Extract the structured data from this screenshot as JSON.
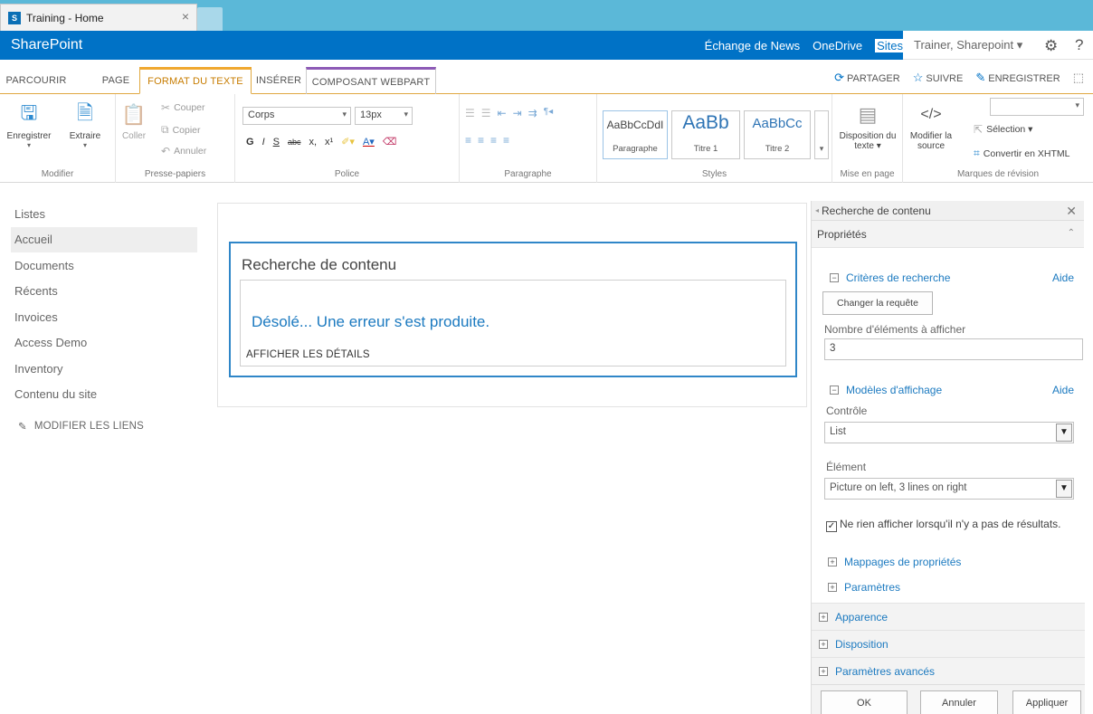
{
  "browser": {
    "tab_title": "Training - Home",
    "close": "×",
    "favicon": "S"
  },
  "suite": {
    "brand": "SharePoint",
    "links": [
      "Échange de News",
      "OneDrive",
      "Sites"
    ],
    "user": "Trainer, Sharepoint ▾",
    "settings_icon": "gear-icon",
    "help": "?"
  },
  "ribbon": {
    "tabs": [
      "PARCOURIR",
      "PAGE",
      "FORMAT DU TEXTE",
      "INSÉRER",
      "COMPOSANT WEBPART"
    ],
    "actions": {
      "share": "PARTAGER",
      "follow": "SUIVRE",
      "save": "ENREGISTRER"
    },
    "groups": {
      "modifier": {
        "label": "Modifier",
        "save": "Enregistrer",
        "extract": "Extraire"
      },
      "clipboard": {
        "label": "Presse-papiers",
        "paste": "Coller",
        "cut": "Couper",
        "copy": "Copier",
        "undo": "Annuler"
      },
      "font": {
        "label": "Police",
        "font_name": "Corps",
        "font_size": "13px",
        "bold": "G",
        "italic": "I",
        "underline": "S",
        "strike": "abc",
        "sub": "x,",
        "sup": "x¹"
      },
      "paragraph": {
        "label": "Paragraphe"
      },
      "styles": {
        "label": "Styles",
        "items": [
          {
            "sample": "AaBbCcDdI",
            "name": "Paragraphe"
          },
          {
            "sample": "AaBb",
            "name": "Titre 1"
          },
          {
            "sample": "AaBbCc",
            "name": "Titre 2"
          }
        ]
      },
      "layout": {
        "label": "Mise en page",
        "text_layout": "Disposition du texte ▾"
      },
      "markup": {
        "label": "Marques de révision",
        "edit_source": "Modifier la source",
        "selection": "Sélection ▾",
        "convert": "Convertir en XHTML"
      }
    }
  },
  "leftnav": {
    "items": [
      "Listes",
      "Accueil",
      "Documents",
      "Récents",
      "Invoices",
      "Access Demo",
      "Inventory",
      "Contenu du site"
    ],
    "edit_links": "MODIFIER LES LIENS"
  },
  "webpart": {
    "title": "Recherche de contenu",
    "error": "Désolé... Une erreur s'est produite.",
    "details": "AFFICHER LES DÉTAILS"
  },
  "toolpane": {
    "title": "Recherche de contenu",
    "properties": "Propriétés",
    "search_criteria": "Critères de recherche",
    "help": "Aide",
    "change_query": "Changer la requête",
    "item_count_label": "Nombre d'éléments à afficher",
    "item_count_value": "3",
    "display_templates": "Modèles d'affichage",
    "control_label": "Contrôle",
    "control_value": "List",
    "element_label": "Élément",
    "element_value": "Picture on left, 3 lines on right",
    "no_results_checkbox": "Ne rien afficher lorsqu'il n'y a pas de résultats.",
    "property_mappings": "Mappages de propriétés",
    "settings": "Paramètres",
    "appearance": "Apparence",
    "layout": "Disposition",
    "advanced": "Paramètres avancés",
    "ok": "OK",
    "cancel": "Annuler",
    "apply": "Appliquer"
  }
}
